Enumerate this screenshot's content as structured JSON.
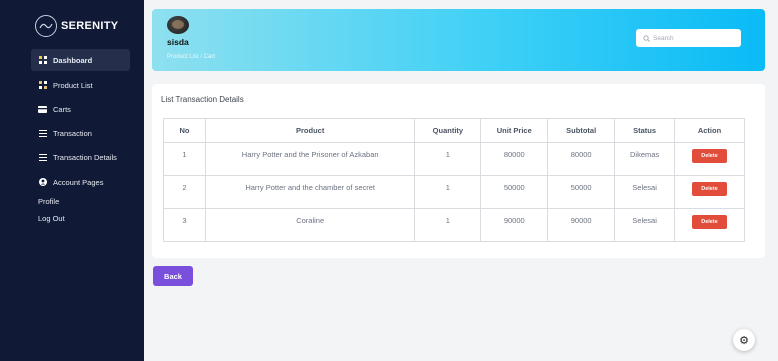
{
  "brand": {
    "name": "SERENITY"
  },
  "sidebar": {
    "items": [
      {
        "label": "Dashboard",
        "icon": "dashboard-icon"
      },
      {
        "label": "Product List",
        "icon": "grid-icon"
      },
      {
        "label": "Carts",
        "icon": "card-icon"
      },
      {
        "label": "Transaction",
        "icon": "list-icon"
      },
      {
        "label": "Transaction Details",
        "icon": "list-icon"
      },
      {
        "label": "Account Pages",
        "icon": "user-icon"
      }
    ],
    "sub_items": [
      "Profile",
      "Log Out"
    ]
  },
  "header": {
    "user_name": "sisda",
    "breadcrumb": "Product List  /  Cart",
    "search_placeholder": "Search"
  },
  "card": {
    "title": "List Transaction Details",
    "columns": [
      "No",
      "Product",
      "Quantity",
      "Unit Price",
      "Subtotal",
      "Status",
      "Action"
    ],
    "rows": [
      {
        "no": "1",
        "product": "Harry Potter and the Prisoner of Azkaban",
        "quantity": "1",
        "unit_price": "80000",
        "subtotal": "80000",
        "status": "Dikemas",
        "action": "Delete"
      },
      {
        "no": "2",
        "product": "Harry Potter and the chamber of secret",
        "quantity": "1",
        "unit_price": "50000",
        "subtotal": "50000",
        "status": "Selesai",
        "action": "Delete"
      },
      {
        "no": "3",
        "product": "Coraline",
        "quantity": "1",
        "unit_price": "90000",
        "subtotal": "90000",
        "status": "Selesai",
        "action": "Delete"
      }
    ]
  },
  "back_label": "Back",
  "colors": {
    "sidebar": "#101935",
    "delete": "#e24c3b",
    "back": "#7a4fdc",
    "header_start": "#8ee0ef",
    "header_end": "#0abbf6"
  }
}
